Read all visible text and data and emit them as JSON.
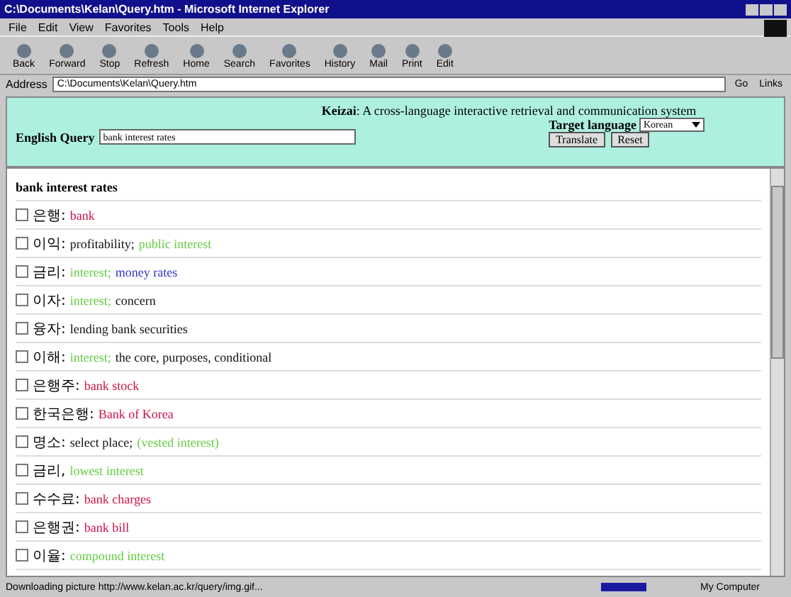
{
  "window": {
    "title": "C:\\Documents\\Kelan\\Query.htm - Microsoft Internet Explorer"
  },
  "menu": [
    "File",
    "Edit",
    "View",
    "Favorites",
    "Tools",
    "Help"
  ],
  "toolbar": [
    "Back",
    "Forward",
    "Stop",
    "Refresh",
    "Home",
    "Search",
    "Favorites",
    "History",
    "Mail",
    "Print",
    "Edit"
  ],
  "address": {
    "label": "Address",
    "value": "C:\\Documents\\Kelan\\Query.htm",
    "go": "Go",
    "links": "Links"
  },
  "form": {
    "heading": "**Keizai**: A cross-language interactive retrieval and communication system",
    "query_label": "English Query",
    "query_value": "bank interest rates",
    "target_label": "Target language",
    "target_value": "Korean",
    "buttons": [
      "Translate",
      "Reset"
    ]
  },
  "results": {
    "heading": "bank interest rates",
    "rows": [
      {
        "checked": false,
        "term": "은행:",
        "senses": [
          {
            "text": "bank",
            "color": "#cc1144"
          }
        ]
      },
      {
        "checked": false,
        "term": "이익:",
        "senses": [
          {
            "text": "profitability;",
            "color": "#111111"
          },
          {
            "text": "public interest",
            "color": "#66cc44"
          }
        ]
      },
      {
        "checked": false,
        "term": "금리:",
        "senses": [
          {
            "text": "interest;",
            "color": "#66cc44"
          },
          {
            "text": "money rates",
            "color": "#3333cc"
          }
        ]
      },
      {
        "checked": false,
        "term": "이자:",
        "senses": [
          {
            "text": "interest;",
            "color": "#66cc44"
          },
          {
            "text": "concern",
            "color": "#111111"
          }
        ]
      },
      {
        "checked": false,
        "term": "융자:",
        "senses": [
          {
            "text": "lending bank securities",
            "color": "#111111"
          }
        ]
      },
      {
        "checked": false,
        "term": "이해:",
        "senses": [
          {
            "text": "interest;",
            "color": "#66cc44"
          },
          {
            "text": "the core, purposes, conditional",
            "color": "#111111"
          }
        ]
      },
      {
        "checked": false,
        "term": "은행주:",
        "senses": [
          {
            "text": "bank stock",
            "color": "#cc1144"
          }
        ]
      },
      {
        "checked": false,
        "term": "한국은행:",
        "senses": [
          {
            "text": "Bank of Korea",
            "color": "#cc1144"
          }
        ]
      },
      {
        "checked": false,
        "term": "명소:",
        "senses": [
          {
            "text": "select place;",
            "color": "#111111"
          },
          {
            "text": "(vested interest)",
            "color": "#66cc44"
          }
        ]
      },
      {
        "checked": false,
        "term": "금리,",
        "senses": [
          {
            "text": "lowest interest",
            "color": "#66cc44"
          }
        ]
      },
      {
        "checked": false,
        "term": "수수료:",
        "senses": [
          {
            "text": "bank charges",
            "color": "#cc1144"
          }
        ]
      },
      {
        "checked": false,
        "term": "은행권:",
        "senses": [
          {
            "text": "bank bill",
            "color": "#cc1144"
          }
        ]
      },
      {
        "checked": false,
        "term": "이율:",
        "senses": [
          {
            "text": "compound interest",
            "color": "#66cc44"
          }
        ]
      }
    ]
  },
  "status_bar": {
    "text": "Downloading picture http://www.kelan.ac.kr/query/img.gif...",
    "zone": "My Computer"
  }
}
